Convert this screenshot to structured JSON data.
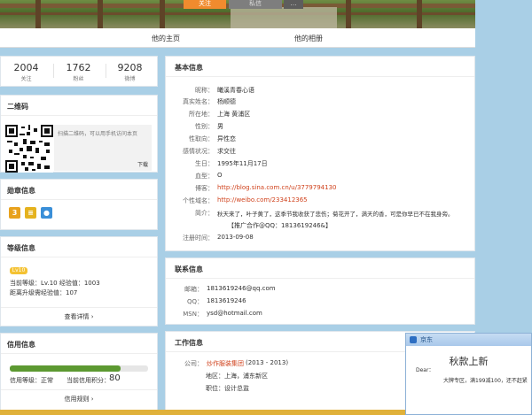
{
  "banner": {
    "btn1": "关注",
    "btn2": "私信",
    "btn3": "…"
  },
  "nav": {
    "home": "他的主页",
    "album": "他的相册"
  },
  "stats": [
    {
      "num": "2004",
      "label": "关注"
    },
    {
      "num": "1762",
      "label": "粉丝"
    },
    {
      "num": "9208",
      "label": "微博"
    }
  ],
  "qrcode": {
    "title": "二维码",
    "desc": "扫描二维码，可以用手机访问本页",
    "download": "下载"
  },
  "medals": {
    "title": "勋章信息",
    "items": [
      "medal-3-icon",
      "medal-book-icon",
      "medal-blue-icon"
    ]
  },
  "level": {
    "title": "等级信息",
    "badge": "Lv10",
    "current": "当前等级：Lv.10  经验值：1003",
    "next": "距离升级需经验值：107",
    "more": "查看详情 ›"
  },
  "credit": {
    "title": "信用信息",
    "level": "信用等级：正常",
    "score_label": "当前信用积分：",
    "score": "80",
    "score_fraction": 0.8,
    "rules": "信用规则 ›"
  },
  "basic": {
    "title": "基本信息",
    "rows": [
      {
        "k": "昵称：",
        "v": "曦溪青春心语"
      },
      {
        "k": "真实姓名：",
        "v": "杨顺德"
      },
      {
        "k": "所在地：",
        "v": "上海 黄浦区"
      },
      {
        "k": "性别：",
        "v": "男"
      },
      {
        "k": "性取向：",
        "v": "异性恋"
      },
      {
        "k": "感情状况：",
        "v": "求交往"
      },
      {
        "k": "生日：",
        "v": "1995年11月17日"
      },
      {
        "k": "血型：",
        "v": "O"
      },
      {
        "k": "博客：",
        "v": "http://blog.sina.com.cn/u/3779794130"
      },
      {
        "k": "个性域名：",
        "v": "http://weibo.com/233412365"
      },
      {
        "k": "简介：",
        "v": "秋天来了，叶子黄了，这季节我收获了悲伤；菊花开了，满天的香，可是你早已不在我身旁。"
      },
      {
        "k": "",
        "v": "【推广合作@QQ：1813619246&】"
      },
      {
        "k": "注册时间：",
        "v": "2013-09-08"
      }
    ]
  },
  "contact": {
    "title": "联系信息",
    "rows": [
      {
        "k": "邮箱：",
        "v": "1813619246@qq.com"
      },
      {
        "k": "QQ：",
        "v": "1813619246"
      },
      {
        "k": "MSN：",
        "v": "ysd@hotmail.com"
      }
    ]
  },
  "work": {
    "title": "工作信息",
    "company_k": "公司：",
    "company": "炒作服装集团",
    "years": "(2013 - 2013)",
    "area": "地区：上海，浦东新区",
    "position": "职位：设计总监"
  },
  "popup": {
    "app": "京东",
    "title": "秋款上新",
    "dear": "Dear：",
    "body": "大牌专区，满199减100，还不赶紧"
  }
}
